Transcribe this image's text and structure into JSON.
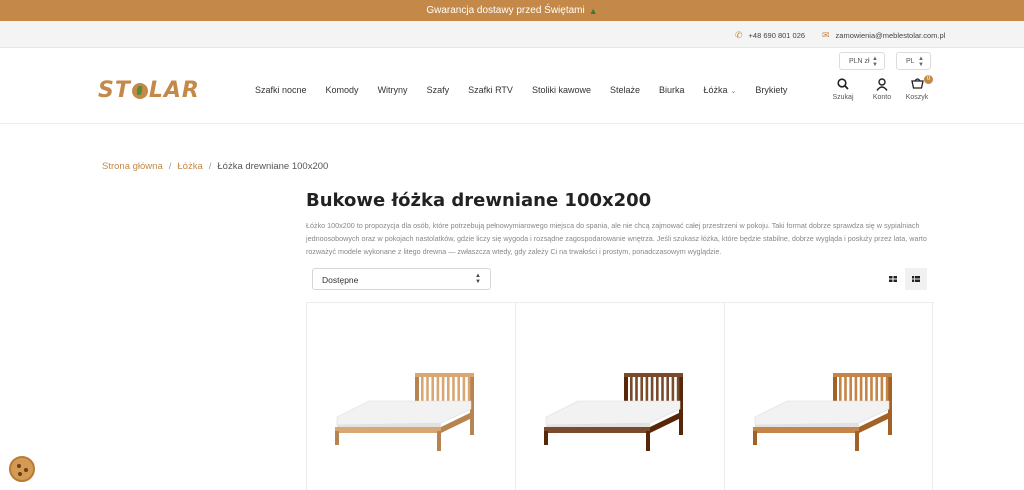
{
  "promo": {
    "text": "Gwarancja dostawy przed Świętami",
    "icon": "tree-icon"
  },
  "contact": {
    "phone": "+48 690 801 026",
    "email": "zamowienia@meblestolar.com.pl"
  },
  "logo": {
    "text_before": "ST",
    "text_after": "LAR"
  },
  "selectors": {
    "currency": "PLN zł",
    "language": "PL"
  },
  "nav": {
    "items": [
      {
        "label": "Szafki nocne"
      },
      {
        "label": "Komody"
      },
      {
        "label": "Witryny"
      },
      {
        "label": "Szafy"
      },
      {
        "label": "Szafki RTV"
      },
      {
        "label": "Stoliki kawowe"
      },
      {
        "label": "Stelaże"
      },
      {
        "label": "Biurka"
      },
      {
        "label": "Łóżka"
      },
      {
        "label": "Brykiety"
      }
    ]
  },
  "tools": {
    "search": "Szukaj",
    "account": "Konto",
    "cart": "Koszyk",
    "cart_count": "0"
  },
  "breadcrumb": {
    "home": "Strona główna",
    "category": "Łóżka",
    "current": "Łóżka drewniane 100x200"
  },
  "page": {
    "title": "Bukowe łóżka drewniane 100x200",
    "description": "Łóżko 100x200 to propozycja dla osób, które potrzebują pełnowymiarowego miejsca do spania, ale nie chcą zajmować całej przestrzeni w pokoju. Taki format dobrze sprawdza się w sypialniach jednoosobowych oraz w pokojach nastolatków, gdzie liczy się wygoda i rozsądne zagospodarowanie wnętrza. Jeśli szukasz łóżka, które będzie stabilne, dobrze wygląda i posłuży przez lata, warto rozważyć modele wykonane z litego drewna — zwłaszcza wtedy, gdy zależy Ci na trwałości i prostym, ponadczasowym wyglądzie."
  },
  "filter": {
    "value": "Dostępne"
  },
  "products": [
    {
      "color": "#d8a774"
    },
    {
      "color": "#7a4a2c"
    },
    {
      "color": "#c58448"
    }
  ],
  "colors": {
    "accent": "#c48948"
  }
}
